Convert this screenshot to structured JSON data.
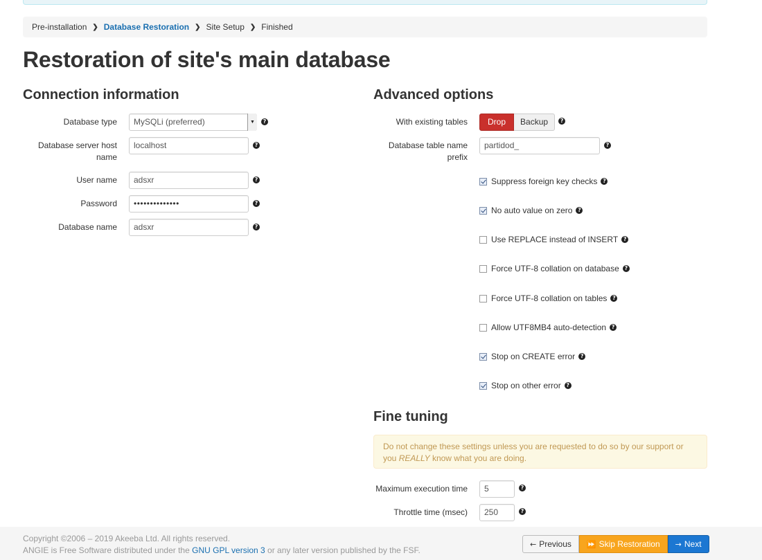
{
  "breadcrumb": {
    "items": [
      "Pre-installation",
      "Database Restoration",
      "Site Setup",
      "Finished"
    ],
    "separator": "❯"
  },
  "page_title": "Restoration of site's main database",
  "connection": {
    "title": "Connection information",
    "db_type_label": "Database type",
    "db_type_value": "MySQLi (preferred)",
    "host_label_1": "Database server host",
    "host_label_2": "name",
    "host_value": "localhost",
    "user_label": "User name",
    "user_value": "adsxr",
    "password_label": "Password",
    "password_value": "••••••••••••••",
    "dbname_label": "Database name",
    "dbname_value": "adsxr"
  },
  "advanced": {
    "title": "Advanced options",
    "existing_label": "With existing tables",
    "drop_label": "Drop",
    "backup_label": "Backup",
    "prefix_label_1": "Database table name",
    "prefix_label_2": "prefix",
    "prefix_value": "partidod_",
    "options": [
      {
        "label": "Suppress foreign key checks",
        "checked": true
      },
      {
        "label": "No auto value on zero",
        "checked": true
      },
      {
        "label": "Use REPLACE instead of INSERT",
        "checked": false
      },
      {
        "label": "Force UTF-8 collation on database",
        "checked": false
      },
      {
        "label": "Force UTF-8 collation on tables",
        "checked": false
      },
      {
        "label": "Allow UTF8MB4 auto-detection",
        "checked": false
      },
      {
        "label": "Stop on CREATE error",
        "checked": true
      },
      {
        "label": "Stop on other error",
        "checked": true
      }
    ]
  },
  "fine_tuning": {
    "title": "Fine tuning",
    "warning_1": "Do not change these settings unless you are requested to do so by our support or",
    "warning_2a": "you ",
    "warning_2b": "REALLY",
    "warning_2c": " know what you are doing.",
    "max_exec_label": "Maximum execution time",
    "max_exec_value": "5",
    "throttle_label": "Throttle time (msec)",
    "throttle_value": "250"
  },
  "footer": {
    "copyright": "Copyright ©2006 – 2019 Akeeba Ltd. All rights reserved.",
    "license_a": "ANGIE is Free Software distributed under the ",
    "license_link": "GNU GPL version 3",
    "license_b": " or any later version published by the FSF."
  },
  "nav": {
    "previous_label": "Previous",
    "skip_label": "Skip Restoration",
    "next_label": "Next"
  },
  "help_glyph": "?",
  "colors": {
    "drop_active": "#c9302c",
    "skip": "#f8a51e",
    "next": "#1c77d2",
    "link": "#1a6fb0",
    "warning_text": "#c09853"
  }
}
